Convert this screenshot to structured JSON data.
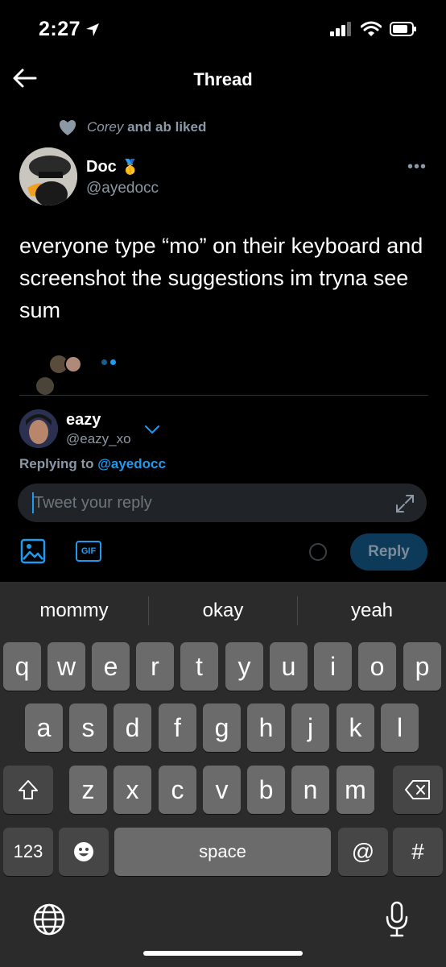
{
  "status": {
    "time": "2:27"
  },
  "header": {
    "title": "Thread"
  },
  "social_context": {
    "liker": "Corey",
    "rest": "and ab liked"
  },
  "tweet": {
    "name": "Doc",
    "badge": "🥇",
    "handle": "@ayedocc",
    "more": "•••",
    "text": "everyone type “mo” on their keyboard and screenshot the suggestions im tryna see sum"
  },
  "reply": {
    "name": "eazy",
    "handle": "@eazy_xo",
    "replying_prefix": "Replying to",
    "replying_to": "@ayedocc",
    "placeholder": "Tweet your reply",
    "gif_label": "GIF",
    "reply_button": "Reply"
  },
  "keyboard": {
    "suggestions": [
      "mommy",
      "okay",
      "yeah"
    ],
    "row1": [
      "q",
      "w",
      "e",
      "r",
      "t",
      "y",
      "u",
      "i",
      "o",
      "p"
    ],
    "row2": [
      "a",
      "s",
      "d",
      "f",
      "g",
      "h",
      "j",
      "k",
      "l"
    ],
    "row3": [
      "z",
      "x",
      "c",
      "v",
      "b",
      "n",
      "m"
    ],
    "numbers_label": "123",
    "space_label": "space",
    "at_label": "@",
    "hash_label": "#"
  },
  "colors": {
    "accent": "#1d9bf0",
    "background": "#000000",
    "keyboard": "#2b2b2b",
    "key": "#6b6b6b"
  }
}
